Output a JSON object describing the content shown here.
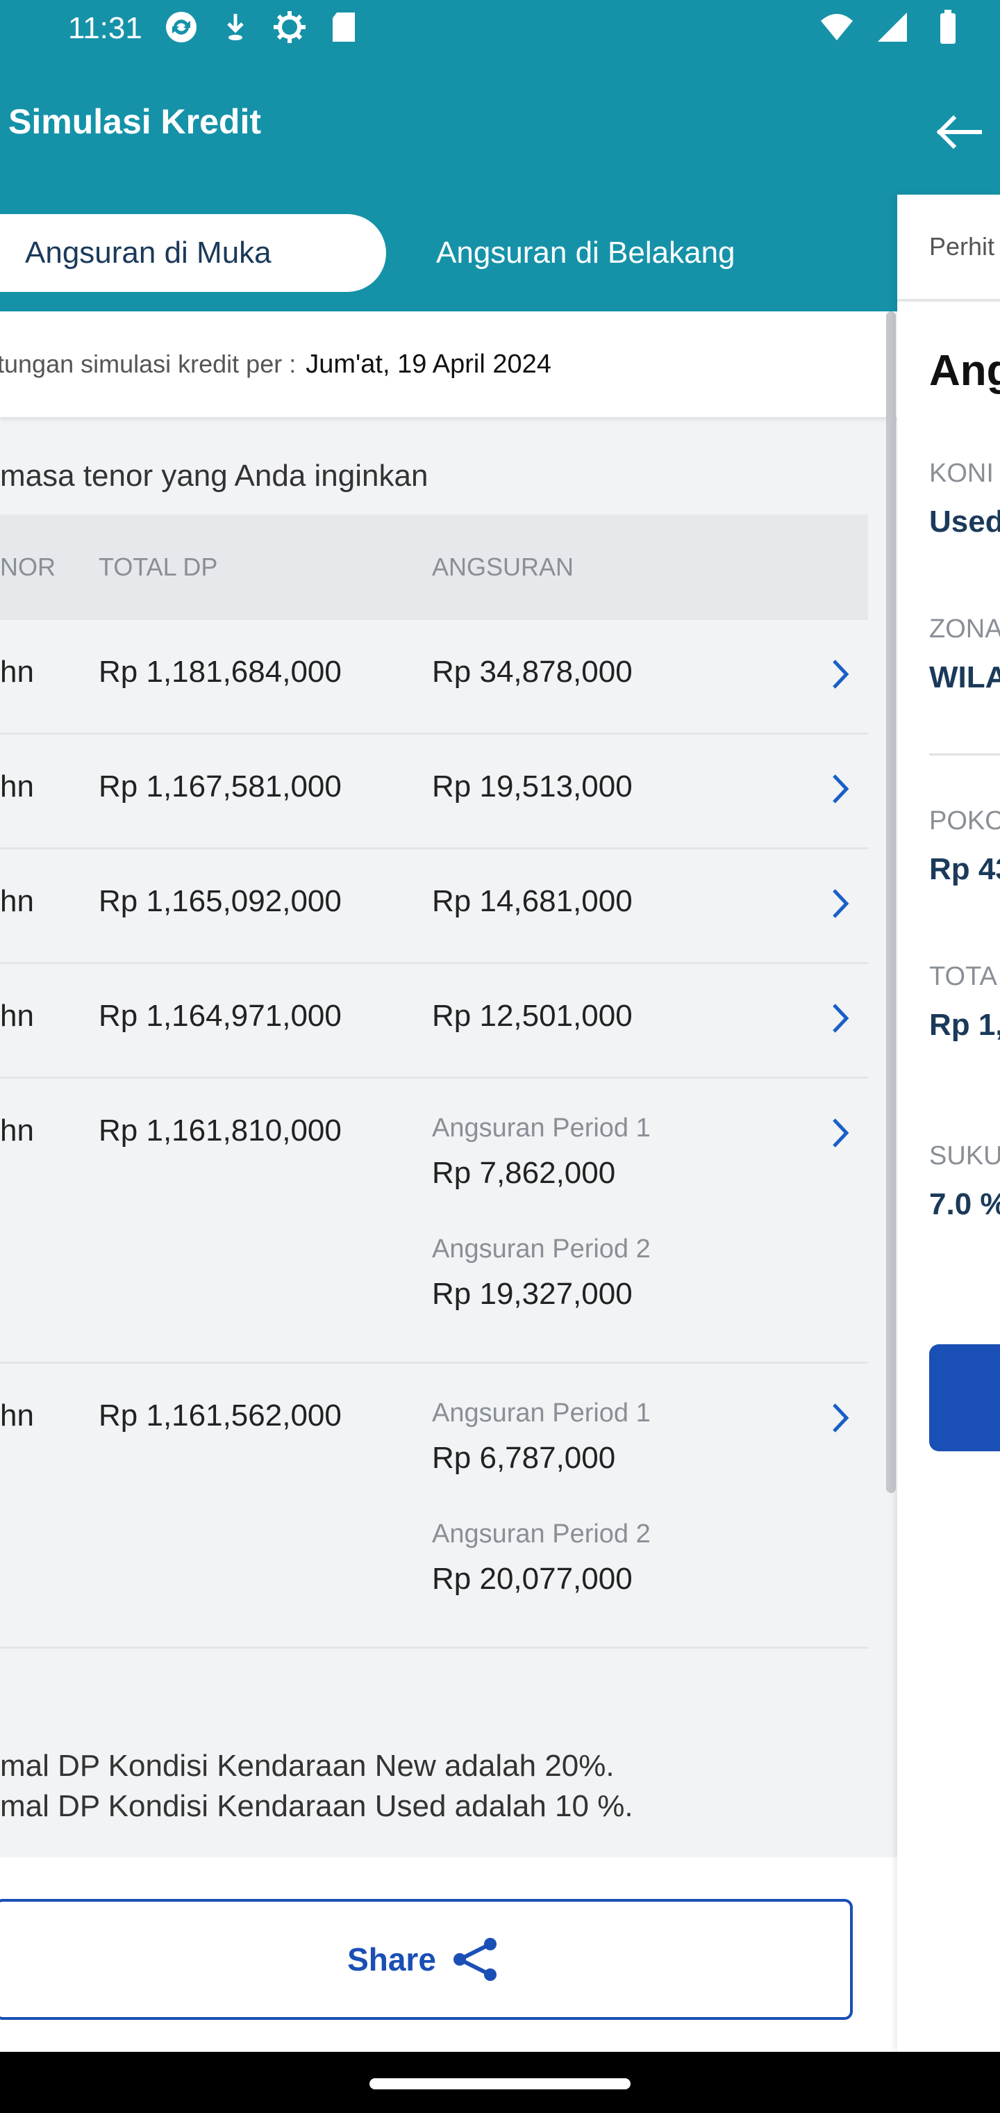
{
  "status_bar": {
    "time": "11:31",
    "icons_left": [
      "sync-icon",
      "download-icon",
      "settings-icon",
      "sd-card-icon"
    ],
    "icons_right": [
      "wifi-icon",
      "signal-icon",
      "battery-icon"
    ]
  },
  "header": {
    "title": "Simulasi Kredit",
    "back_icon": "arrow-left-icon"
  },
  "tabs": [
    {
      "label": "Angsuran di Muka",
      "active": true
    },
    {
      "label": "Angsuran di Belakang",
      "active": false
    }
  ],
  "date_bar": {
    "label": "tungan simulasi kredit per :",
    "value": "Jum'at, 19 April 2024"
  },
  "subtitle": "masa tenor yang Anda inginkan",
  "table": {
    "headers": {
      "tenor": "NOR",
      "dp": "TOTAL DP",
      "angsuran": "ANGSURAN"
    },
    "rows": [
      {
        "tenor": "hn",
        "dp": "Rp 1,181,684,000",
        "angsuran": "Rp 34,878,000"
      },
      {
        "tenor": "hn",
        "dp": "Rp 1,167,581,000",
        "angsuran": "Rp 19,513,000"
      },
      {
        "tenor": "hn",
        "dp": "Rp 1,165,092,000",
        "angsuran": "Rp 14,681,000"
      },
      {
        "tenor": "hn",
        "dp": "Rp 1,164,971,000",
        "angsuran": "Rp 12,501,000"
      },
      {
        "tenor": "hn",
        "dp": "Rp 1,161,810,000",
        "p1_label": "Angsuran Period 1",
        "p1_value": "Rp 7,862,000",
        "p2_label": "Angsuran Period 2",
        "p2_value": "Rp 19,327,000"
      },
      {
        "tenor": "hn",
        "dp": "Rp 1,161,562,000",
        "p1_label": "Angsuran Period 1",
        "p1_value": "Rp 6,787,000",
        "p2_label": "Angsuran Period 2",
        "p2_value": "Rp 20,077,000"
      }
    ]
  },
  "notes": [
    "mal DP Kondisi Kendaraan New adalah 20%.",
    "mal DP Kondisi Kendaraan Used adalah 10 %."
  ],
  "share": {
    "label": "Share",
    "icon": "share-icon"
  },
  "side_panel": {
    "tab_label": "Perhit",
    "title": "Ang",
    "fields": [
      {
        "label": "KONI",
        "value": "Used"
      },
      {
        "label": "ZONA",
        "value": "WILA"
      },
      {
        "label": "POKO",
        "value": "Rp 43"
      },
      {
        "label": "TOTA",
        "value": "Rp 1,"
      },
      {
        "label": "SUKU",
        "value": "7.0 %"
      }
    ]
  },
  "colors": {
    "header_bg": "#1592a8",
    "accent_blue": "#1a4fb5",
    "chevron_blue": "#1a5fc8"
  }
}
